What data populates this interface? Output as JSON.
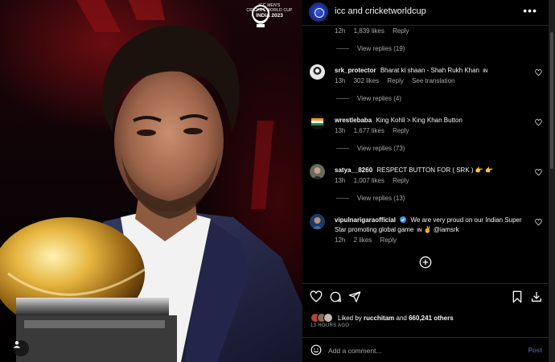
{
  "media": {
    "logo": {
      "line1": "ICC MEN'S",
      "line2": "CRICKET WORLD CUP",
      "line3": "INDIA 2023"
    },
    "tag_icon": "user-tag-icon"
  },
  "header": {
    "title": "icc and cricketworldcup",
    "more_icon": "more-horizontal-icon"
  },
  "top_partial": {
    "time": "12h",
    "likes": "1,839 likes",
    "reply": "Reply",
    "view_replies": "View replies (19)"
  },
  "comments": [
    {
      "username": "srk_protector",
      "text": "Bharat ki shaan - Shah Rukh Khan",
      "flag": "IN",
      "time": "13h",
      "likes": "302 likes",
      "reply": "Reply",
      "extra": "See translation",
      "view_replies": "View replies (4)"
    },
    {
      "username": "wrestlebaba",
      "text": "King Kohli > King Khan Button",
      "flag": "",
      "time": "13h",
      "likes": "1,677 likes",
      "reply": "Reply",
      "extra": "",
      "view_replies": "View replies (73)"
    },
    {
      "username": "satya__8260",
      "text": "RESPECT BUTTON FOR ( SRK ) 👉 👉",
      "flag": "",
      "time": "13h",
      "likes": "1,007 likes",
      "reply": "Reply",
      "extra": "",
      "view_replies": "View replies (13)"
    },
    {
      "username": "vipulnarigaraofficial",
      "text_part1": "We are very proud on our Indian Super Star promoting global game",
      "flag": "IN",
      "text_part2": "✌️ @iamsrk",
      "time": "12h",
      "likes": "2 likes",
      "reply": "Reply",
      "verified": true
    }
  ],
  "actions": {
    "like_icon": "heart-icon",
    "comment_icon": "comment-icon",
    "share_icon": "send-icon",
    "save_icon": "bookmark-icon",
    "download_icon": "download-icon",
    "liked_by_prefix": "Liked by",
    "liked_by_user": "rucchitam",
    "liked_by_and": "and",
    "liked_by_others": "660,241 others",
    "time": "13 HOURS AGO"
  },
  "comment_box": {
    "placeholder": "Add a comment...",
    "post_label": "Post"
  },
  "colors": {
    "background": "#000000",
    "text": "#f5f5f5",
    "muted": "#a8a8a8",
    "post_disabled": "#3b5a8a",
    "verified": "#3897f0"
  }
}
